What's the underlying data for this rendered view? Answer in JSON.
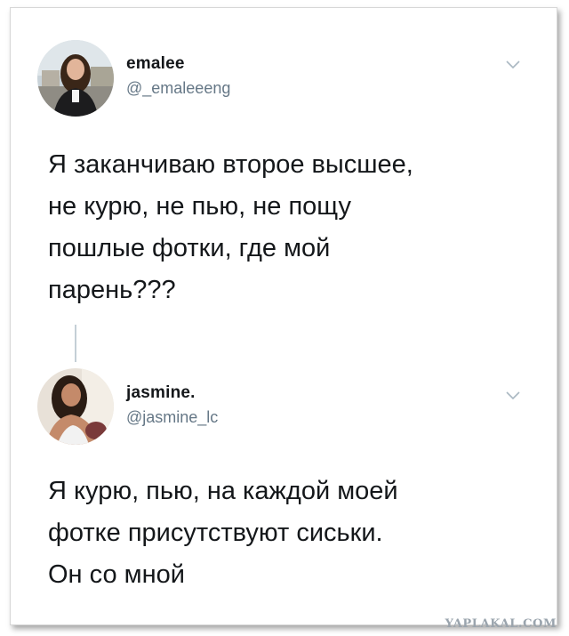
{
  "tweet1": {
    "display_name": "emalee",
    "handle": "@_emaleeeng",
    "lines": [
      "Я заканчиваю второе высшее,",
      "не курю, не пью, не пощу",
      "пошлые фотки, где мой",
      "парень???"
    ],
    "menu_icon": "chevron-down-icon"
  },
  "tweet2": {
    "display_name": "jasmine.",
    "handle": "@jasmine_lc",
    "lines": [
      "Я курю, пью, на каждой моей",
      "фотке присутствуют сиськи.",
      "Он со мной"
    ],
    "menu_icon": "chevron-down-icon"
  },
  "watermark": "YAPLAKAL.COM",
  "colors": {
    "text": "#14171a",
    "secondary": "#657786",
    "thread_line": "#c4cfd6"
  }
}
